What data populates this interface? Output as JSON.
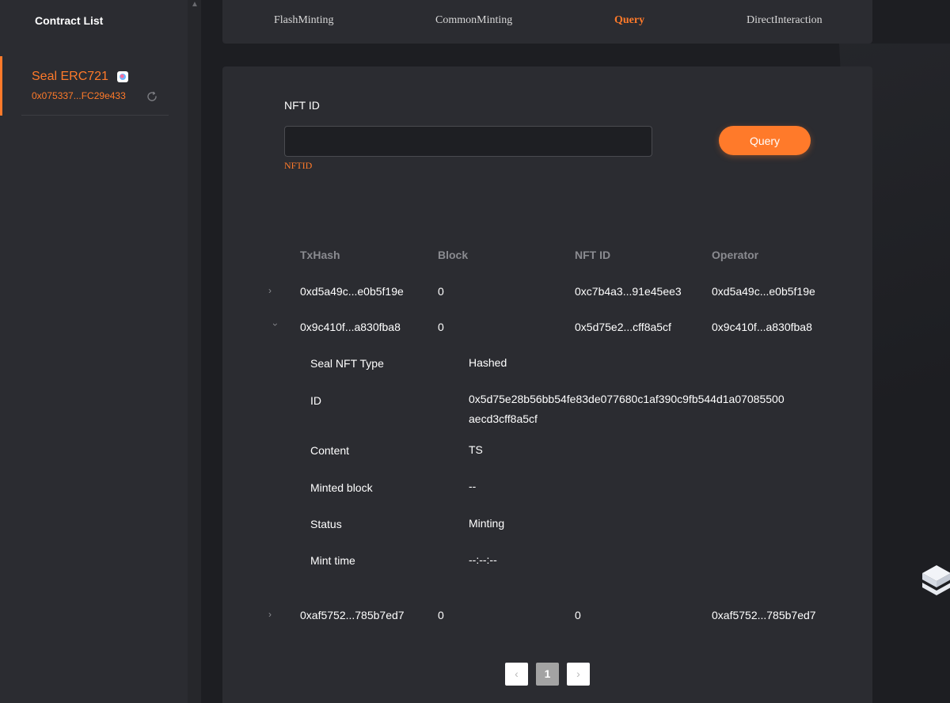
{
  "sidebar": {
    "title": "Contract List",
    "contracts": [
      {
        "name": "Seal ERC721",
        "address": "0x075337...FC29e433"
      }
    ]
  },
  "tabs": [
    {
      "label": "FlashMinting"
    },
    {
      "label": "CommonMinting"
    },
    {
      "label": "Query",
      "active": true
    },
    {
      "label": "DirectInteraction"
    }
  ],
  "query_form": {
    "field_label": "NFT ID",
    "input_value": "",
    "input_placeholder": "",
    "hint": "NFTID",
    "button_label": "Query"
  },
  "table": {
    "headers": [
      "TxHash",
      "Block",
      "NFT ID",
      "Operator"
    ],
    "rows": [
      {
        "txhash": "0xd5a49c...e0b5f19e",
        "block": "0",
        "nft_id": "0xc7b4a3...91e45ee3",
        "operator": "0xd5a49c...e0b5f19e",
        "expanded": false
      },
      {
        "txhash": "0x9c410f...a830fba8",
        "block": "0",
        "nft_id": "0x5d75e2...cff8a5cf",
        "operator": "0x9c410f...a830fba8",
        "expanded": true
      },
      {
        "txhash": "0xaf5752...785b7ed7",
        "block": "0",
        "nft_id": "0",
        "operator": "0xaf5752...785b7ed7",
        "expanded": false
      }
    ],
    "detail": {
      "type_label": "Seal NFT Type",
      "type_value": "Hashed",
      "id_label": "ID",
      "id_value_line1": "0x5d75e28b56bb54fe83de077680c1af390c9fb544d1a07085500",
      "id_value_line2": "aecd3cff8a5cf",
      "content_label": "Content",
      "content_value": "TS",
      "minted_block_label": "Minted block",
      "minted_block_value": "--",
      "status_label": "Status",
      "status_value": "Minting",
      "mint_time_label": "Mint time",
      "mint_time_value": "--:--:--"
    }
  },
  "pagination": {
    "prev": "‹",
    "current": "1",
    "next": "›"
  },
  "colors": {
    "accent": "#ff7a2a",
    "panel": "#2b2c31",
    "background": "#1d1e22"
  }
}
